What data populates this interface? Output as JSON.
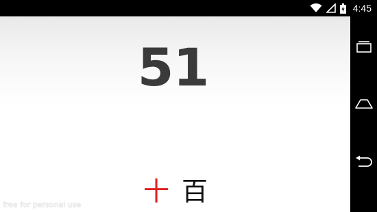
{
  "status_bar": {
    "time": "4:45",
    "icons": [
      "wifi-icon",
      "signal-icon",
      "battery-icon"
    ]
  },
  "main": {
    "number": "51",
    "characters": [
      {
        "text": "十",
        "color": "#e02020"
      },
      {
        "text": "百",
        "color": "#111111"
      }
    ],
    "watermark": "free for personal use"
  },
  "nav_bar": {
    "buttons": [
      "recent-apps-icon",
      "home-icon",
      "back-icon"
    ]
  },
  "colors": {
    "number": "#3a3a3a",
    "highlight": "#e02020",
    "status_bar": "#000000"
  }
}
